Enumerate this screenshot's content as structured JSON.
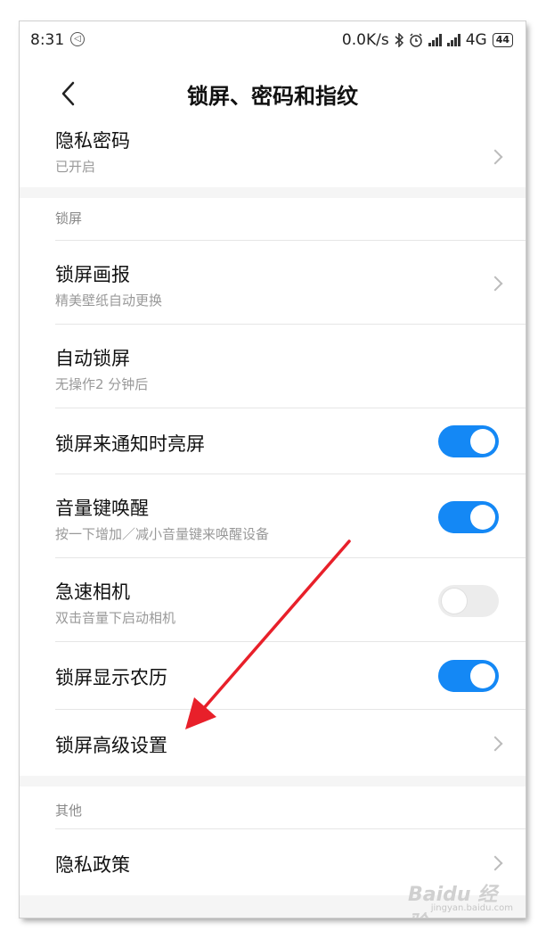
{
  "status": {
    "time": "8:31",
    "dnd_icon": "dnd-icon",
    "speed": "0.0K/s",
    "network": "4G",
    "battery": "44",
    "colors": {
      "toggle_on": "#1488f5",
      "toggle_off": "#ececec",
      "annotation_arrow": "#e8202a"
    }
  },
  "header": {
    "title": "锁屏、密码和指纹"
  },
  "items": {
    "privacy_password": {
      "label": "隐私密码",
      "sub": "已开启"
    },
    "lockscreen_pictorial": {
      "label": "锁屏画报",
      "sub": "精美壁纸自动更换"
    },
    "auto_lock": {
      "label": "自动锁屏",
      "sub": "无操作2 分钟后"
    },
    "wake_on_notification": {
      "label": "锁屏来通知时亮屏",
      "enabled": true
    },
    "volume_key_wake": {
      "label": "音量键唤醒",
      "sub": "按一下增加／减小音量键来唤醒设备",
      "enabled": true
    },
    "quick_camera": {
      "label": "急速相机",
      "sub": "双击音量下启动相机",
      "enabled": false
    },
    "lunar_calendar": {
      "label": "锁屏显示农历",
      "enabled": true
    },
    "advanced_settings": {
      "label": "锁屏高级设置"
    },
    "privacy_policy": {
      "label": "隐私政策"
    }
  },
  "sections": {
    "lockscreen": "锁屏",
    "other": "其他"
  },
  "watermark": {
    "brand": "Baidu 经验",
    "url": "jingyan.baidu.com"
  }
}
